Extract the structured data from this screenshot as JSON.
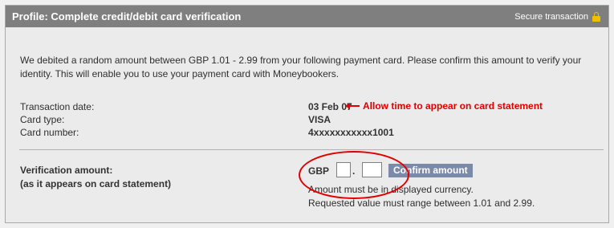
{
  "header": {
    "title": "Profile: Complete credit/debit card verification",
    "secure_text": "Secure transaction"
  },
  "intro": "We debited a random amount between GBP 1.01 - 2.99 from your following payment card. Please confirm this amount to verify your identity. This will enable you to use your payment card with Moneybookers.",
  "details": [
    {
      "label": "Transaction date:",
      "value": "03 Feb 07"
    },
    {
      "label": "Card type:",
      "value": "VISA"
    },
    {
      "label": "Card number:",
      "value": "4xxxxxxxxxxx1001"
    }
  ],
  "annotation": "Allow time to appear on card statement",
  "verification": {
    "label_line1": "Verification amount:",
    "label_line2": "(as it appears on card statement)",
    "currency": "GBP",
    "separator": ".",
    "whole_value": "",
    "decimal_value": "",
    "confirm_label": "Confirm amount",
    "hint_line1": "Amount must be in displayed currency.",
    "hint_line2": "Requested value must range between 1.01 and 2.99."
  },
  "colors": {
    "header_bg": "#7f7f7f",
    "panel_bg": "#ebebeb",
    "annotation": "#e00000",
    "button_bg": "#7a8aa8",
    "lock": "#f0c000"
  },
  "icons": [
    "lock-icon",
    "left-arrow-icon"
  ]
}
